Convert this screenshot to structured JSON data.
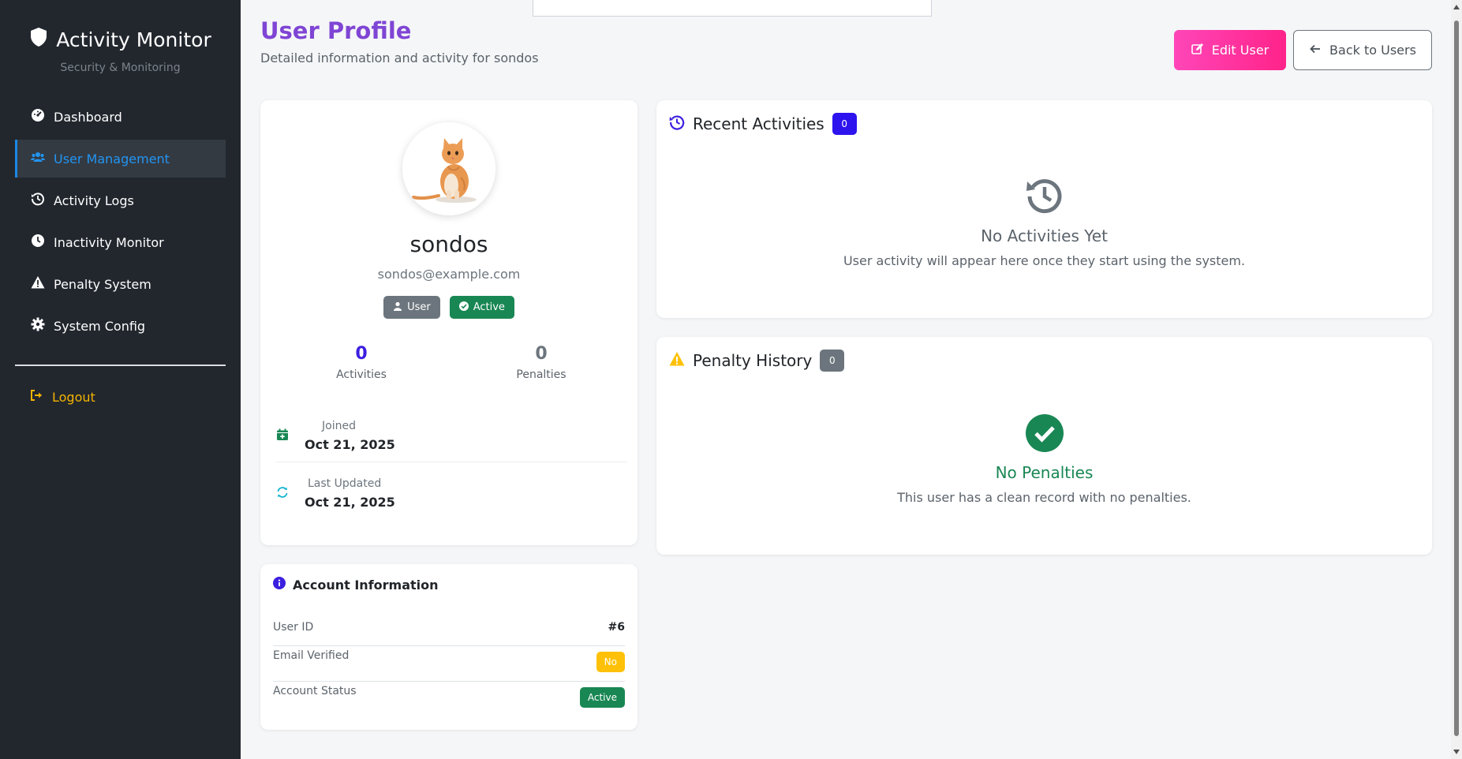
{
  "sidebar": {
    "brand_title": "Activity Monitor",
    "brand_subtitle": "Security & Monitoring",
    "items": [
      {
        "label": "Dashboard",
        "icon": "gauge-icon"
      },
      {
        "label": "User Management",
        "icon": "users-icon",
        "active": true
      },
      {
        "label": "Activity Logs",
        "icon": "history-icon"
      },
      {
        "label": "Inactivity Monitor",
        "icon": "clock-icon"
      },
      {
        "label": "Penalty System",
        "icon": "warning-icon"
      },
      {
        "label": "System Config",
        "icon": "gear-icon"
      }
    ],
    "logout": "Logout"
  },
  "header": {
    "title": "User Profile",
    "subtitle": "Detailed information and activity for sondos",
    "edit_label": "Edit User",
    "back_label": "Back to Users"
  },
  "profile": {
    "username": "sondos",
    "email": "sondos@example.com",
    "role_badge": "User",
    "status_badge": "Active",
    "activities_count": "0",
    "activities_label": "Activities",
    "penalties_count": "0",
    "penalties_label": "Penalties",
    "joined_label": "Joined",
    "joined_value": "Oct 21, 2025",
    "updated_label": "Last Updated",
    "updated_value": "Oct 21, 2025"
  },
  "account": {
    "title": "Account Information",
    "user_id_label": "User ID",
    "user_id_value": "#6",
    "email_verified_label": "Email Verified",
    "email_verified_value": "No",
    "status_label": "Account Status",
    "status_value": "Active"
  },
  "activities": {
    "title": "Recent Activities",
    "count": "0",
    "empty_title": "No Activities Yet",
    "empty_text": "User activity will appear here once they start using the system."
  },
  "penalties": {
    "title": "Penalty History",
    "count": "0",
    "empty_title": "No Penalties",
    "empty_text": "This user has a clean record with no penalties."
  },
  "colors": {
    "sidebar_bg": "#22272e",
    "accent_blue": "#2295f2",
    "title_purple": "#7f45d4",
    "edit_pink": "#ff2389",
    "success": "#198754",
    "warning": "#ffc107",
    "count_blue": "#2d14ee"
  }
}
